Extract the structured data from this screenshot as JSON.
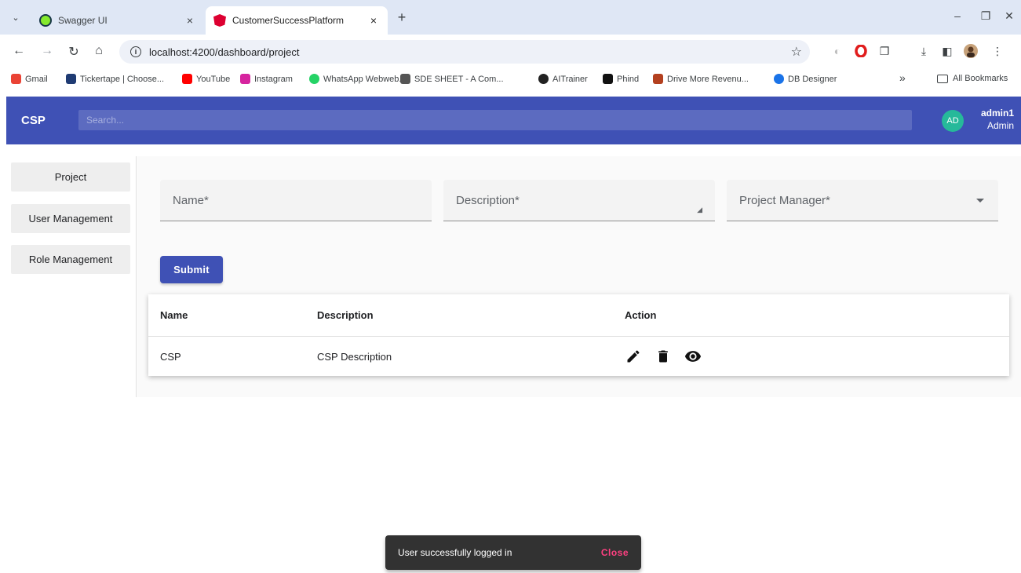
{
  "browser": {
    "tabs": [
      {
        "title": "Swagger UI",
        "icon": "swagger-icon"
      },
      {
        "title": "CustomerSuccessPlatform",
        "icon": "angular-icon",
        "active": true
      }
    ],
    "new_tab": "+",
    "url": "localhost:4200/dashboard/project",
    "bookmarks": [
      {
        "label": "Gmail",
        "color": "#ea4335"
      },
      {
        "label": "Tickertape | Choose...",
        "color": "#1f3b73"
      },
      {
        "label": "YouTube",
        "color": "#ff0000"
      },
      {
        "label": "Instagram",
        "color": "#d6249f"
      },
      {
        "label": "WhatsApp Webweb...",
        "color": "#25d366"
      },
      {
        "label": "SDE SHEET - A Com...",
        "color": "#555555"
      },
      {
        "label": "AITrainer",
        "color": "#222222"
      },
      {
        "label": "Phind",
        "color": "#111111"
      },
      {
        "label": "Drive More Revenu...",
        "color": "#b3401f"
      },
      {
        "label": "DB Designer",
        "color": "#1a73e8"
      }
    ],
    "bookmarks_more": "»",
    "all_bookmarks": "All Bookmarks"
  },
  "header": {
    "logo": "CSP",
    "search_placeholder": "Search...",
    "avatar_initials": "AD",
    "user_name": "admin1",
    "user_role": "Admin",
    "primary_color": "#3f51b5"
  },
  "sidebar": {
    "items": [
      {
        "label": "Project"
      },
      {
        "label": "User Management"
      },
      {
        "label": "Role Management"
      }
    ]
  },
  "form": {
    "name_label": "Name*",
    "description_label": "Description*",
    "manager_label": "Project Manager*",
    "submit_label": "Submit"
  },
  "table": {
    "columns": [
      "Name",
      "Description",
      "Action"
    ],
    "rows": [
      {
        "name": "CSP",
        "description": "CSP Description"
      }
    ]
  },
  "snackbar": {
    "message": "User successfully logged in",
    "action": "Close",
    "action_color": "#ff4081"
  }
}
